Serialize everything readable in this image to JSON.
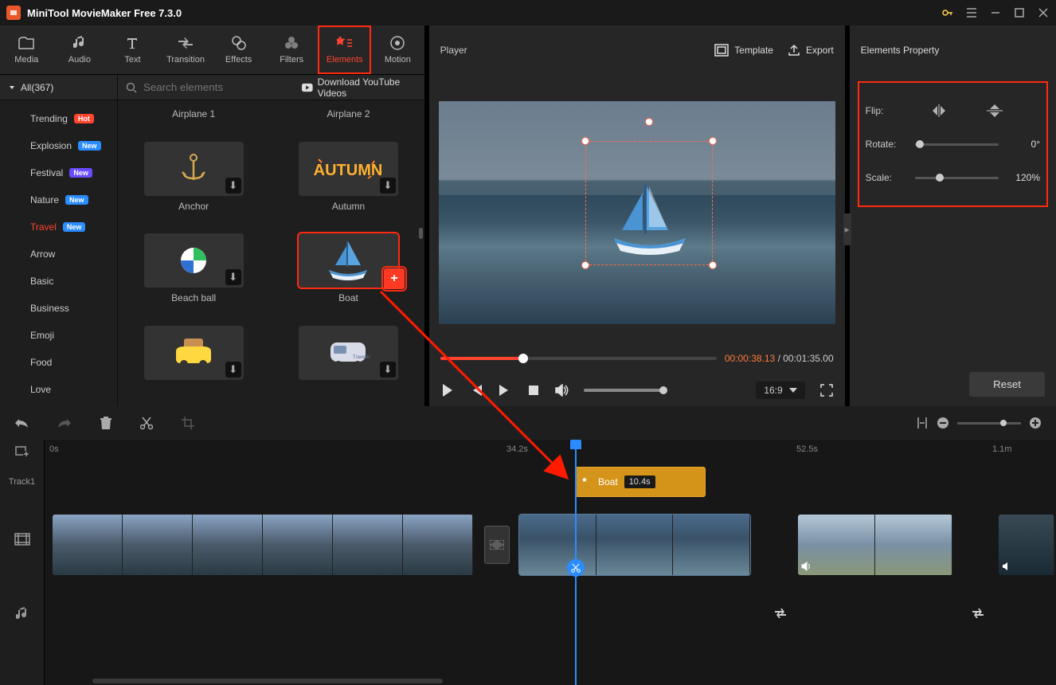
{
  "app": {
    "title": "MiniTool MovieMaker Free 7.3.0"
  },
  "tabs": [
    {
      "label": "Media"
    },
    {
      "label": "Audio"
    },
    {
      "label": "Text"
    },
    {
      "label": "Transition"
    },
    {
      "label": "Effects"
    },
    {
      "label": "Filters"
    },
    {
      "label": "Elements"
    },
    {
      "label": "Motion"
    }
  ],
  "sidebar": {
    "all_label": "All(367)",
    "items": [
      {
        "label": "Trending",
        "badge": "Hot",
        "bcls": "bd-hot"
      },
      {
        "label": "Explosion",
        "badge": "New",
        "bcls": "bd-new"
      },
      {
        "label": "Festival",
        "badge": "New",
        "bcls": "bd-new2"
      },
      {
        "label": "Nature",
        "badge": "New",
        "bcls": "bd-new"
      },
      {
        "label": "Travel",
        "badge": "New",
        "bcls": "bd-new",
        "sel": true
      },
      {
        "label": "Arrow"
      },
      {
        "label": "Basic"
      },
      {
        "label": "Business"
      },
      {
        "label": "Emoji"
      },
      {
        "label": "Food"
      },
      {
        "label": "Love"
      }
    ]
  },
  "search": {
    "placeholder": "Search elements"
  },
  "yt": {
    "label": "Download YouTube Videos"
  },
  "elements": [
    {
      "label": "Airplane 1"
    },
    {
      "label": "Airplane 2"
    },
    {
      "label": "Anchor",
      "dl": true
    },
    {
      "label": "Autumn",
      "dl": true
    },
    {
      "label": "Beach ball",
      "dl": true
    },
    {
      "label": "Boat",
      "sel": true,
      "add": true
    },
    {
      "label": "",
      "dl": true
    },
    {
      "label": "",
      "dl": true
    }
  ],
  "player": {
    "title": "Player",
    "template": "Template",
    "export": "Export",
    "current": "00:00:38.13",
    "total": "00:01:35.00",
    "aspect": "16:9"
  },
  "props": {
    "title": "Elements Property",
    "flip_label": "Flip:",
    "rotate_label": "Rotate:",
    "rotate_val": "0°",
    "scale_label": "Scale:",
    "scale_val": "120%",
    "reset": "Reset"
  },
  "timeline": {
    "marks": [
      "0s",
      "34.2s",
      "52.5s",
      "1.1m"
    ],
    "track1": "Track1",
    "elem_clip": {
      "name": "Boat",
      "dur": "10.4s"
    }
  }
}
